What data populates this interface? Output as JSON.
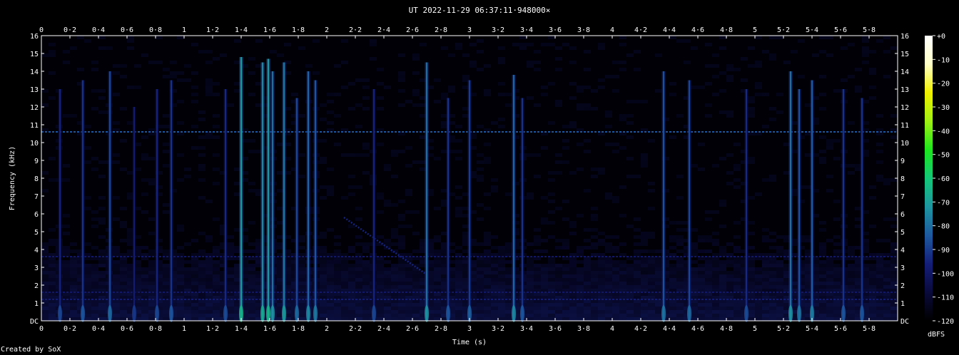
{
  "chart_data": {
    "type": "heatmap",
    "title": "UT 2022-11-29 06:37:11·948000×",
    "xlabel": "Time (s)",
    "ylabel": "Frequency (kHz)",
    "xlim": [
      0,
      5.96
    ],
    "ylim": [
      0,
      16
    ],
    "x_ticks": [
      "0",
      "0·2",
      "0·4",
      "0·6",
      "0·8",
      "1",
      "1·2",
      "1·4",
      "1·6",
      "1·8",
      "2",
      "2·2",
      "2·4",
      "2·6",
      "2·8",
      "3",
      "3·2",
      "3·4",
      "3·6",
      "3·8",
      "4",
      "4·2",
      "4·4",
      "4·6",
      "4·8",
      "5",
      "5·2",
      "5·4",
      "5·6",
      "5·8"
    ],
    "y_ticks": [
      "DC",
      "1",
      "2",
      "3",
      "4",
      "5",
      "6",
      "7",
      "8",
      "9",
      "10",
      "11",
      "12",
      "13",
      "14",
      "15",
      "16"
    ],
    "colorbar": {
      "label": "dBFS",
      "ticks": [
        "+0",
        "-10",
        "-20",
        "-30",
        "-40",
        "-50",
        "-60",
        "-70",
        "-80",
        "-90",
        "-100",
        "-110",
        "-120"
      ],
      "range": [
        -120,
        0
      ],
      "colors": [
        "#000000",
        "#0a0a3c",
        "#141e78",
        "#1e5aa0",
        "#1e96a0",
        "#14c878",
        "#1ee61e",
        "#a0f014",
        "#f0f000",
        "#ffffc8",
        "#ffffff"
      ]
    },
    "background_level_dbfs": -115,
    "horizontal_lines": [
      {
        "freq_khz": 10.6,
        "level_dbfs": -85
      },
      {
        "freq_khz": 3.6,
        "level_dbfs": -100
      },
      {
        "freq_khz": 1.6,
        "level_dbfs": -100
      },
      {
        "freq_khz": 1.2,
        "level_dbfs": -98
      }
    ],
    "vertical_events": [
      {
        "t": 0.13,
        "f_max": 13.0,
        "level": -95
      },
      {
        "t": 0.29,
        "f_max": 13.5,
        "level": -92
      },
      {
        "t": 0.48,
        "f_max": 14.0,
        "level": -88
      },
      {
        "t": 0.65,
        "f_max": 12.0,
        "level": -98
      },
      {
        "t": 0.81,
        "f_max": 13.0,
        "level": -95
      },
      {
        "t": 0.91,
        "f_max": 13.5,
        "level": -92
      },
      {
        "t": 1.29,
        "f_max": 13.0,
        "level": -94
      },
      {
        "t": 1.4,
        "f_max": 14.8,
        "level": -72
      },
      {
        "t": 1.55,
        "f_max": 14.5,
        "level": -75
      },
      {
        "t": 1.59,
        "f_max": 14.7,
        "level": -72
      },
      {
        "t": 1.62,
        "f_max": 14.0,
        "level": -80
      },
      {
        "t": 1.7,
        "f_max": 14.5,
        "level": -78
      },
      {
        "t": 1.79,
        "f_max": 12.5,
        "level": -88
      },
      {
        "t": 1.87,
        "f_max": 14.0,
        "level": -82
      },
      {
        "t": 1.92,
        "f_max": 13.5,
        "level": -85
      },
      {
        "t": 2.33,
        "f_max": 13.0,
        "level": -95
      },
      {
        "t": 2.7,
        "f_max": 14.5,
        "level": -80
      },
      {
        "t": 2.85,
        "f_max": 12.5,
        "level": -92
      },
      {
        "t": 3.0,
        "f_max": 13.5,
        "level": -90
      },
      {
        "t": 3.31,
        "f_max": 13.8,
        "level": -82
      },
      {
        "t": 3.37,
        "f_max": 12.5,
        "level": -92
      },
      {
        "t": 4.36,
        "f_max": 14.0,
        "level": -86
      },
      {
        "t": 4.54,
        "f_max": 13.5,
        "level": -88
      },
      {
        "t": 4.94,
        "f_max": 13.0,
        "level": -94
      },
      {
        "t": 5.25,
        "f_max": 14.0,
        "level": -80
      },
      {
        "t": 5.31,
        "f_max": 13.0,
        "level": -86
      },
      {
        "t": 5.4,
        "f_max": 13.5,
        "level": -84
      },
      {
        "t": 5.62,
        "f_max": 13.0,
        "level": -92
      },
      {
        "t": 5.75,
        "f_max": 12.5,
        "level": -92
      }
    ],
    "sweeps": [
      {
        "t_start": 2.12,
        "f_start": 5.8,
        "t_end": 2.7,
        "f_end": 2.6,
        "level": -95
      }
    ],
    "grid": false
  },
  "footer": {
    "credit": "Created by SoX"
  }
}
